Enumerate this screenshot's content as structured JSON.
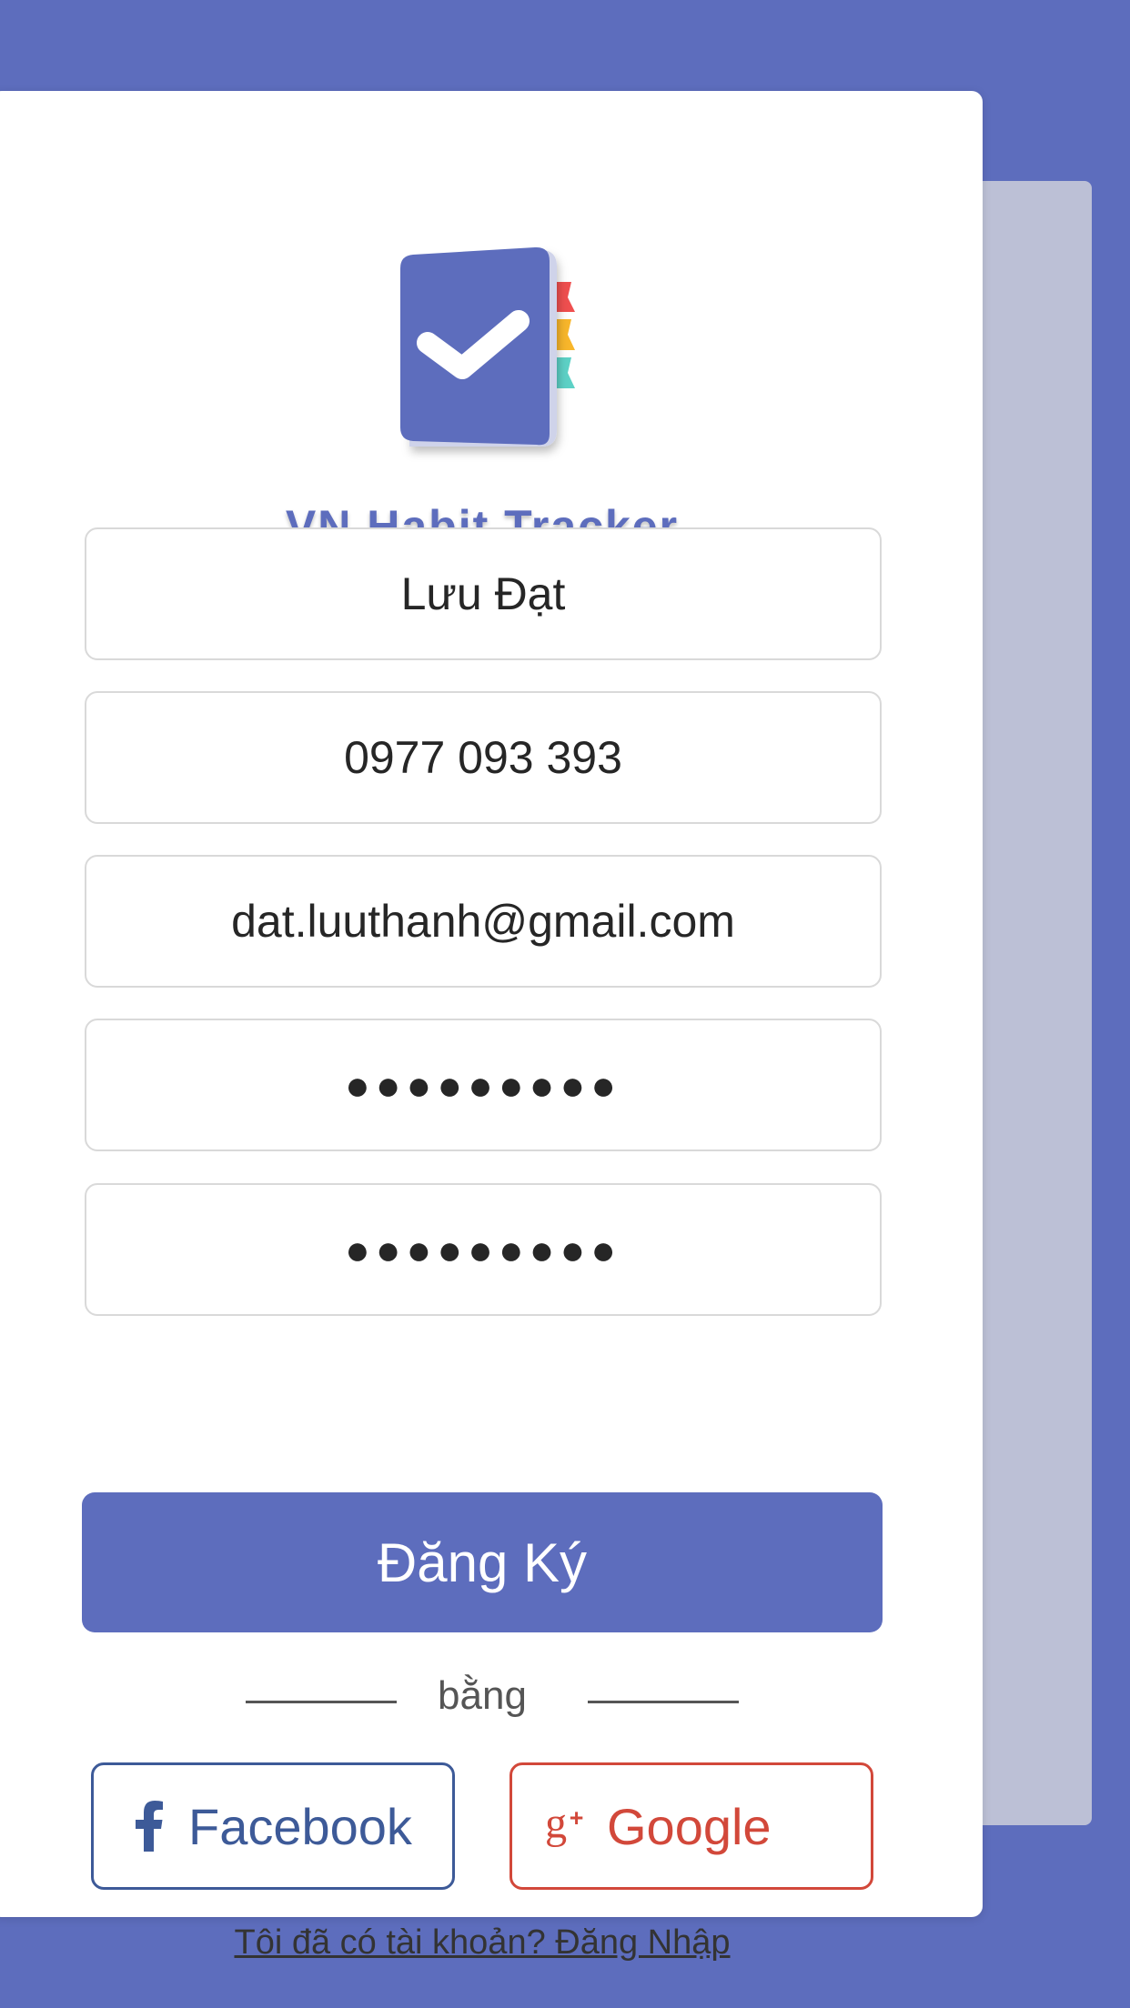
{
  "app": {
    "title": "VN Habit Tracker"
  },
  "form": {
    "full_name": "Lưu Đạt",
    "phone": "0977 093 393",
    "email": "dat.luuthanh@gmail.com",
    "password": "●●●●●●●●●",
    "confirm_password": "●●●●●●●●●"
  },
  "actions": {
    "register_label": "Đăng Ký",
    "divider_text": "bằng",
    "facebook_label": "Facebook",
    "google_label": "Google",
    "login_link": "Tôi đã có tài khoản? Đăng Nhập"
  },
  "icons": {
    "logo": "notebook-check-icon",
    "facebook": "facebook-icon",
    "google": "google-plus-icon"
  },
  "colors": {
    "primary": "#5d6dbd",
    "facebook": "#3d5a98",
    "google": "#d2483a",
    "back_card": "#bcc0d6"
  }
}
